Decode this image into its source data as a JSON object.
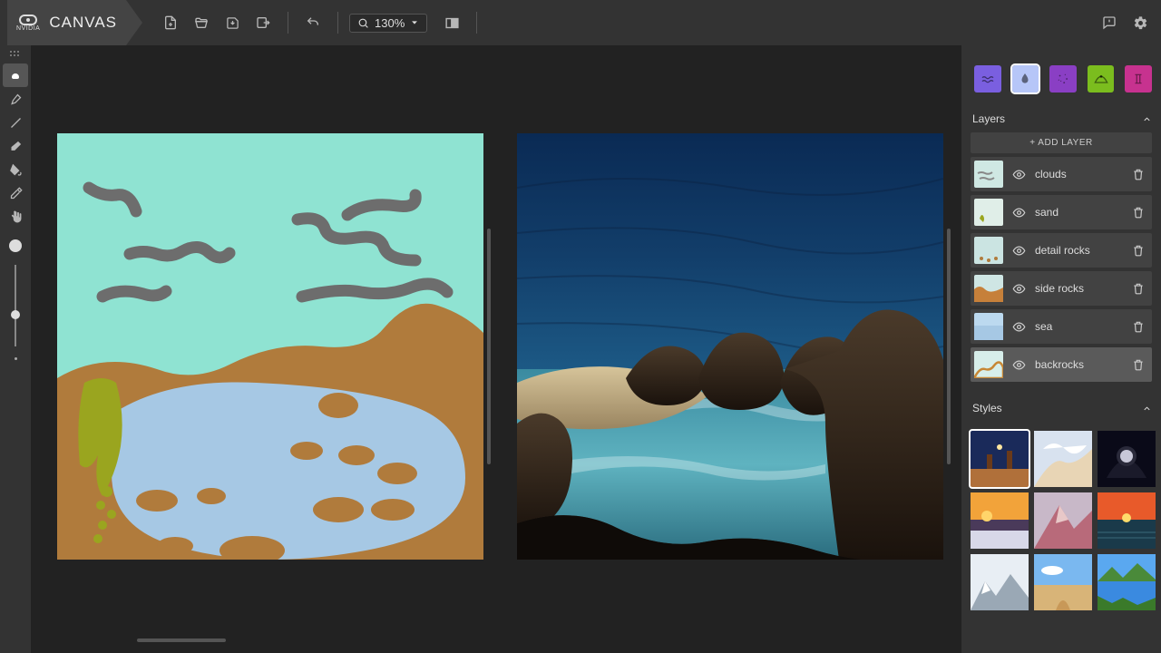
{
  "app": {
    "brand": "NVIDIA",
    "title": "CANVAS"
  },
  "toolbar": {
    "zoom": "130%"
  },
  "materials": [
    {
      "id": "water",
      "color": "#7a5fe0",
      "icon": "waves"
    },
    {
      "id": "sky",
      "color": "#b6c6f8",
      "icon": "drop",
      "selected": true
    },
    {
      "id": "stars",
      "color": "#8a3fc4",
      "icon": "sparkle"
    },
    {
      "id": "land",
      "color": "#7bbd1e",
      "icon": "hill"
    },
    {
      "id": "struct",
      "color": "#c7328f",
      "icon": "pillar"
    }
  ],
  "layers": {
    "header": "Layers",
    "add_label": "+ ADD LAYER",
    "items": [
      {
        "name": "clouds",
        "selected": false,
        "thumb_bg": "#cfe8e3",
        "accent": "#888"
      },
      {
        "name": "sand",
        "selected": false,
        "thumb_bg": "#e0eee8",
        "accent": "#9aa51f"
      },
      {
        "name": "detail rocks",
        "selected": false,
        "thumb_bg": "#cbe4e2",
        "accent": "#b07b3c"
      },
      {
        "name": "side rocks",
        "selected": false,
        "thumb_bg": "#cfe6e4",
        "accent": "#c6803a"
      },
      {
        "name": "sea",
        "selected": false,
        "thumb_bg": "#bcd9ef",
        "accent": "#a6c8e4"
      },
      {
        "name": "backrocks",
        "selected": true,
        "thumb_bg": "#d7eeea",
        "accent": "#c78735"
      }
    ]
  },
  "styles": {
    "header": "Styles",
    "items": [
      {
        "id": "monument",
        "selected": true
      },
      {
        "id": "cloudpeak"
      },
      {
        "id": "nightarch"
      },
      {
        "id": "cloudset"
      },
      {
        "id": "pinkpeak"
      },
      {
        "id": "seasunset"
      },
      {
        "id": "snowpeaks"
      },
      {
        "id": "desertpath"
      },
      {
        "id": "lakemtn"
      }
    ]
  }
}
